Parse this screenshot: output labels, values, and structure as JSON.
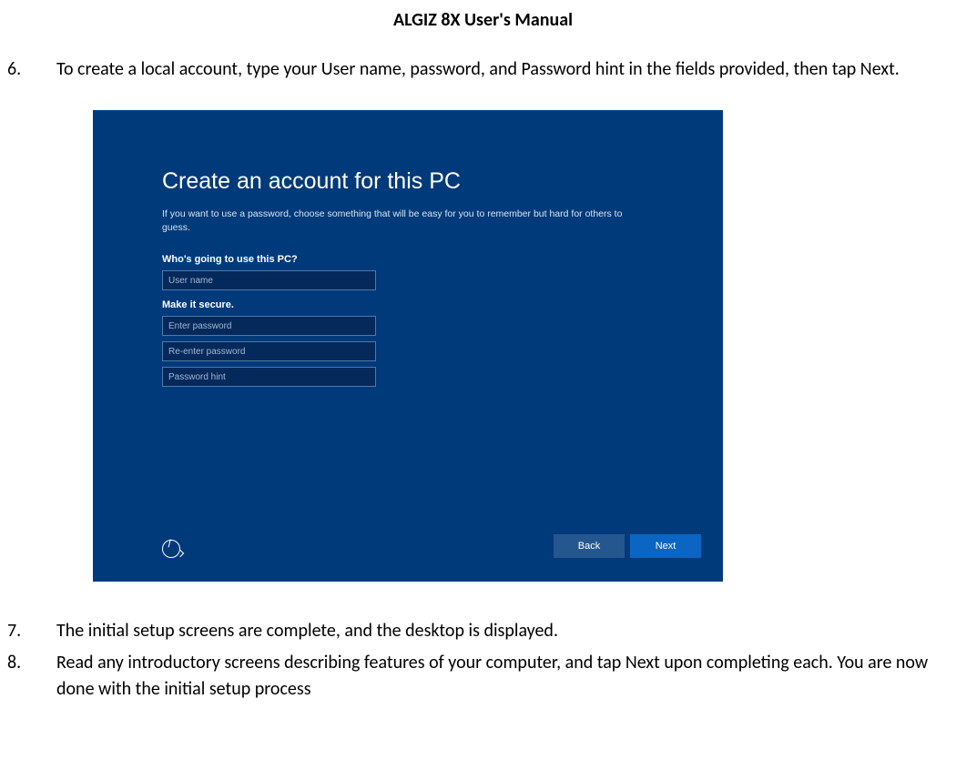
{
  "doc_title": "ALGIZ 8X User's Manual",
  "steps": {
    "s6_num": "6.",
    "s6_text": "To create a local account, type your User name, password, and Password hint in the fields provided, then tap Next.",
    "s7_num": "7.",
    "s7_text": "The initial setup screens are complete, and the desktop is displayed.",
    "s8_num": "8.",
    "s8_text": "Read any introductory screens describing features of your computer, and tap Next upon completing each. You are now done with the initial setup process"
  },
  "win": {
    "heading": "Create an account for this PC",
    "sub": "If you want to use a password, choose something that will be easy for you to remember but hard for others to guess.",
    "label_user": "Who's going to use this PC?",
    "ph_user": "User name",
    "label_secure": "Make it secure.",
    "ph_pass": "Enter password",
    "ph_repass": "Re-enter password",
    "ph_hint": "Password hint",
    "btn_back": "Back",
    "btn_next": "Next"
  }
}
